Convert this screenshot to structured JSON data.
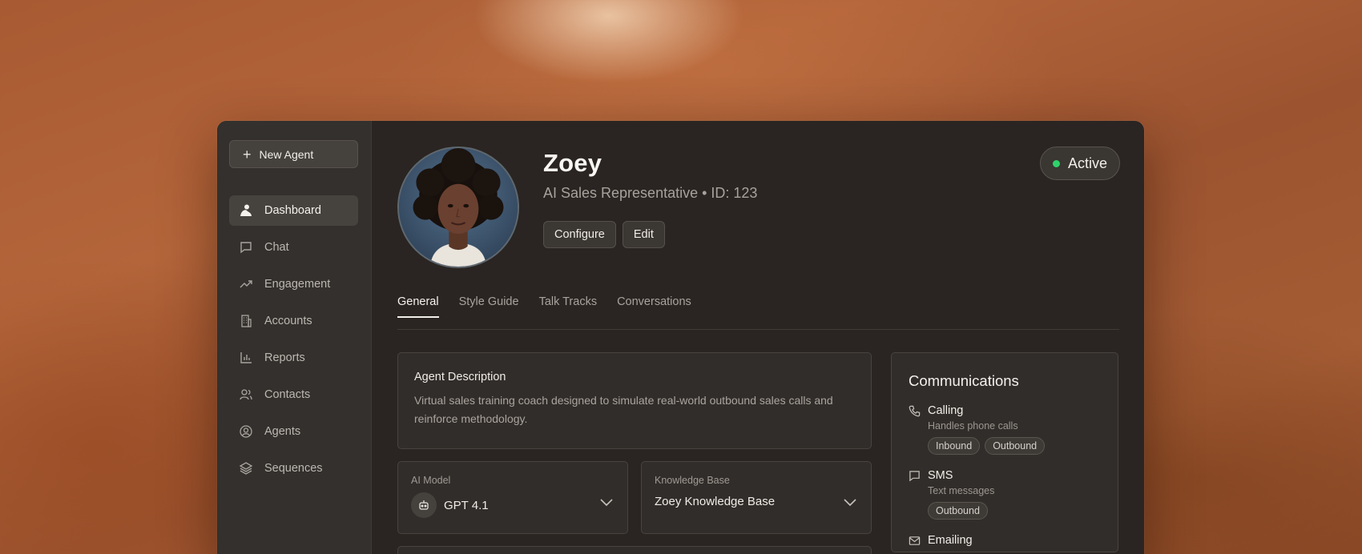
{
  "sidebar": {
    "new_agent_label": "New Agent",
    "items": [
      {
        "label": "Dashboard",
        "icon": "dashboard-icon",
        "active": true
      },
      {
        "label": "Chat",
        "icon": "chat-icon"
      },
      {
        "label": "Engagement",
        "icon": "trending-up-icon"
      },
      {
        "label": "Accounts",
        "icon": "building-icon"
      },
      {
        "label": "Reports",
        "icon": "bar-chart-icon"
      },
      {
        "label": "Contacts",
        "icon": "users-icon"
      },
      {
        "label": "Agents",
        "icon": "user-circle-icon"
      },
      {
        "label": "Sequences",
        "icon": "layers-icon"
      }
    ]
  },
  "profile": {
    "name": "Zoey",
    "subtitle": "AI Sales Representative • ID: 123",
    "configure_label": "Configure",
    "edit_label": "Edit",
    "status_label": "Active",
    "status_color": "#2fd26a"
  },
  "tabs": [
    "General",
    "Style Guide",
    "Talk Tracks",
    "Conversations"
  ],
  "description": {
    "title": "Agent Description",
    "text": "Virtual sales training coach designed to simulate real-world outbound sales calls and reinforce methodology."
  },
  "ai_model": {
    "label": "AI Model",
    "value": "GPT 4.1"
  },
  "knowledge_base": {
    "label": "Knowledge Base",
    "value": "Zoey Knowledge Base"
  },
  "communications": {
    "title": "Communications",
    "channels": [
      {
        "name": "Calling",
        "desc": "Handles phone calls",
        "chips": [
          "Inbound",
          "Outbound"
        ],
        "icon": "phone-icon"
      },
      {
        "name": "SMS",
        "desc": "Text messages",
        "chips": [
          "Outbound"
        ],
        "icon": "message-icon"
      },
      {
        "name": "Emailing",
        "desc": "",
        "chips": [],
        "icon": "mail-icon"
      }
    ]
  }
}
